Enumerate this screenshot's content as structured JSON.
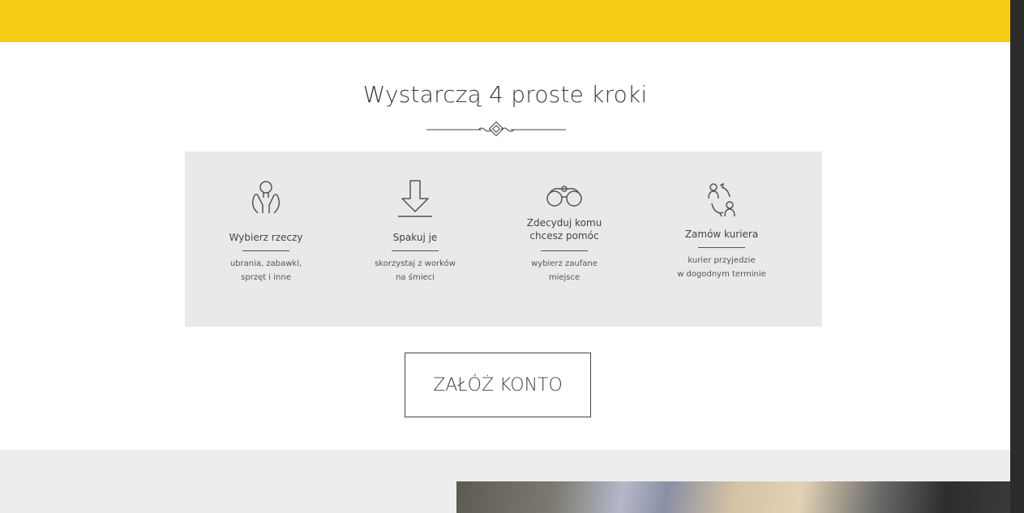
{
  "section": {
    "title": "Wystarczą 4 proste kroki"
  },
  "steps": [
    {
      "icon": "hands-lightbulb-icon",
      "title": "Wybierz rzeczy",
      "desc_line1": "ubrania, zabawki,",
      "desc_line2": "sprzęt i inne"
    },
    {
      "icon": "download-arrow-icon",
      "title": "Spakuj je",
      "desc_line1": "skorzystaj z worków",
      "desc_line2": "na śmieci"
    },
    {
      "icon": "binoculars-icon",
      "title_line1": "Zdecyduj komu",
      "title_line2": "chcesz pomóc",
      "desc_line1": "wybierz  zaufane",
      "desc_line2": "miejsce"
    },
    {
      "icon": "people-exchange-icon",
      "title": "Zamów kuriera",
      "desc_line1": "kurier przyjedzie",
      "desc_line2": "w dogodnym terminie"
    }
  ],
  "cta": {
    "label": "ZAŁÓŻ KONTO"
  },
  "colors": {
    "accent_yellow": "#f7cb14",
    "panel_gray": "#e9e9e9",
    "bottom_gray": "#ebeeed",
    "scrollbar": "#2b2b2b"
  }
}
